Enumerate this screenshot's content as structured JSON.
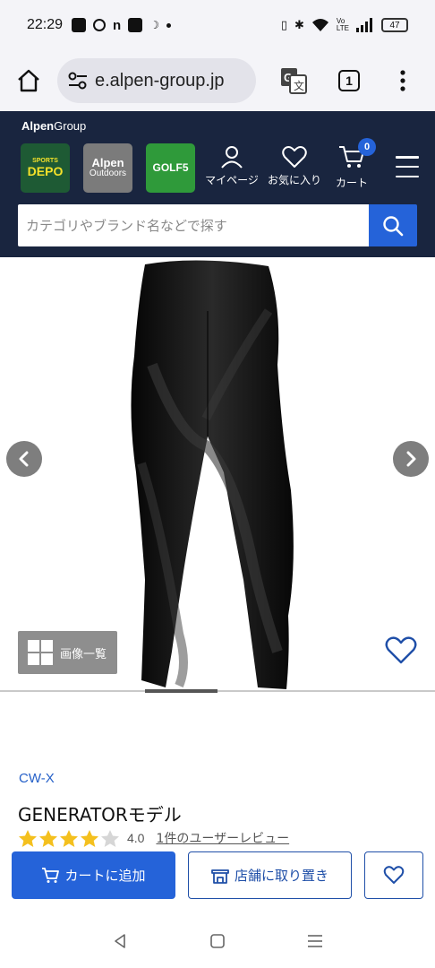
{
  "status_bar": {
    "time": "22:29",
    "battery": "47"
  },
  "browser": {
    "url": "e.alpen-group.jp",
    "tab_count": "1"
  },
  "header": {
    "brand_bold": "Alpen",
    "brand_rest": "Group",
    "stores": {
      "depo_top": "SPORTS",
      "depo_bottom": "DEPO",
      "alpen_top": "Alpen",
      "alpen_bottom": "Outdoors",
      "golf": "GOLF5"
    },
    "nav": {
      "mypage": "マイページ",
      "favorites": "お気に入り",
      "cart": "カート",
      "cart_count": "0"
    },
    "search": {
      "placeholder": "カテゴリやブランド名などで探す"
    }
  },
  "gallery": {
    "image_list_label": "画像一覧",
    "position_fraction": 0.333
  },
  "product": {
    "brand": "CW-X",
    "name": "GENERATORモデル",
    "rating": "4.0",
    "rating_value": 4.0,
    "review_link": "1件のユーザーレビュー"
  },
  "actions": {
    "add_to_cart": "カートに追加",
    "store_reserve": "店舗に取り置き"
  },
  "colors": {
    "header_bg": "#19253f",
    "accent_blue": "#2563d9",
    "brand_link": "#2560c8",
    "star_gold": "#f4c01e"
  }
}
